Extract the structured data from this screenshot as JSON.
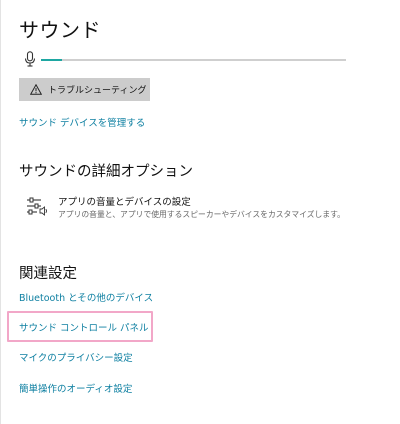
{
  "page": {
    "title": "サウンド"
  },
  "input": {
    "mic_icon": "microphone-icon",
    "volume_level": 0.07,
    "accent_color": "#1ea7a2"
  },
  "troubleshoot": {
    "label": "トラブルシューティング",
    "icon": "warning-icon"
  },
  "links": {
    "manage_devices": "サウンド デバイスを管理する"
  },
  "advanced": {
    "heading": "サウンドの詳細オプション",
    "app_volume": {
      "icon": "mixer-sliders-icon",
      "title": "アプリの音量とデバイスの設定",
      "description": "アプリの音量と、アプリで使用するスピーカーやデバイスをカスタマイズします。"
    }
  },
  "related": {
    "heading": "関連設定",
    "items": [
      "Bluetooth とその他のデバイス",
      "サウンド コントロール パネル",
      "マイクのプライバシー設定",
      "簡単操作のオーディオ設定"
    ],
    "highlight_color": "#f2a7c8"
  },
  "link_color": "#0d7fa1"
}
